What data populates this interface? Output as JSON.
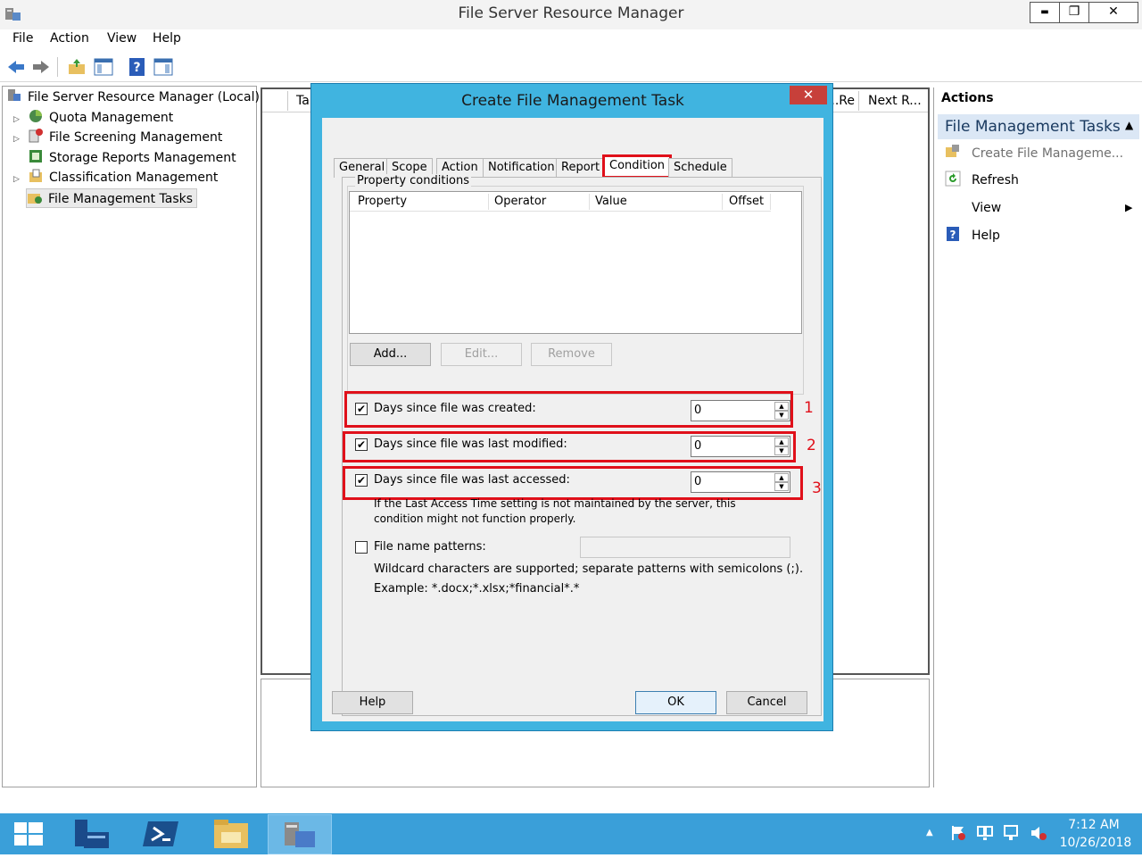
{
  "window": {
    "title": "File Server Resource Manager",
    "controls": {
      "minimize": "▬",
      "restore": "❐",
      "close": "✕"
    }
  },
  "menu": [
    "File",
    "Action",
    "View",
    "Help"
  ],
  "toolbar": [
    "back-arrow",
    "forward-arrow",
    "up-folder",
    "show-hide-tree",
    "help",
    "show-hide-action-pane"
  ],
  "tree": {
    "root": "File Server Resource Manager (Local)",
    "items": [
      {
        "label": "Quota Management",
        "expandable": true
      },
      {
        "label": "File Screening Management",
        "expandable": true
      },
      {
        "label": "Storage Reports Management",
        "expandable": false
      },
      {
        "label": "Classification Management",
        "expandable": true
      },
      {
        "label": "File Management Tasks",
        "expandable": false,
        "selected": true
      }
    ]
  },
  "list_headers": {
    "left": "Ta",
    "r1": "Re...",
    "r2": "Next R..."
  },
  "actions": {
    "header": "Actions",
    "section": "File Management Tasks",
    "items": [
      "Create File Manageme...",
      "Refresh",
      "View",
      "Help"
    ]
  },
  "dialog": {
    "title": "Create File Management Task",
    "close": "✕",
    "tabs": [
      "General",
      "Scope",
      "Action",
      "Notification",
      "Report",
      "Condition",
      "Schedule"
    ],
    "active_tab": "Condition",
    "property_conditions": {
      "group_label": "Property conditions",
      "columns": [
        "Property",
        "Operator",
        "Value",
        "Offset"
      ],
      "buttons": {
        "add": "Add...",
        "edit": "Edit...",
        "remove": "Remove"
      }
    },
    "conditions": [
      {
        "label": "Days since file was created:",
        "checked": true,
        "value": "0",
        "marker": "1"
      },
      {
        "label": "Days since file was last modified:",
        "checked": true,
        "value": "0",
        "marker": "2"
      },
      {
        "label": "Days since file was last accessed:",
        "checked": true,
        "value": "0",
        "marker": "3"
      }
    ],
    "access_note_line1": "If the Last Access Time setting is not maintained by the server, this",
    "access_note_line2": "condition might not function properly.",
    "file_name_patterns": {
      "label": "File name patterns:",
      "checked": false,
      "value": "",
      "hint": "Wildcard characters are supported; separate patterns with semicolons (;).",
      "example": "Example: *.docx;*.xlsx;*financial*.*"
    },
    "footer": {
      "help": "Help",
      "ok": "OK",
      "cancel": "Cancel"
    }
  },
  "taskbar": {
    "apps": [
      "start",
      "server-manager",
      "powershell",
      "file-explorer",
      "fsrm"
    ],
    "tray_icons": [
      "show-hidden-icons-arrow",
      "action-center-flag",
      "network",
      "display",
      "volume-muted"
    ],
    "time": "7:12 AM",
    "date": "10/26/2018"
  },
  "colors": {
    "accent": "#40b4e0",
    "highlight": "#e0101a",
    "taskbar": "#3a9fd9"
  }
}
